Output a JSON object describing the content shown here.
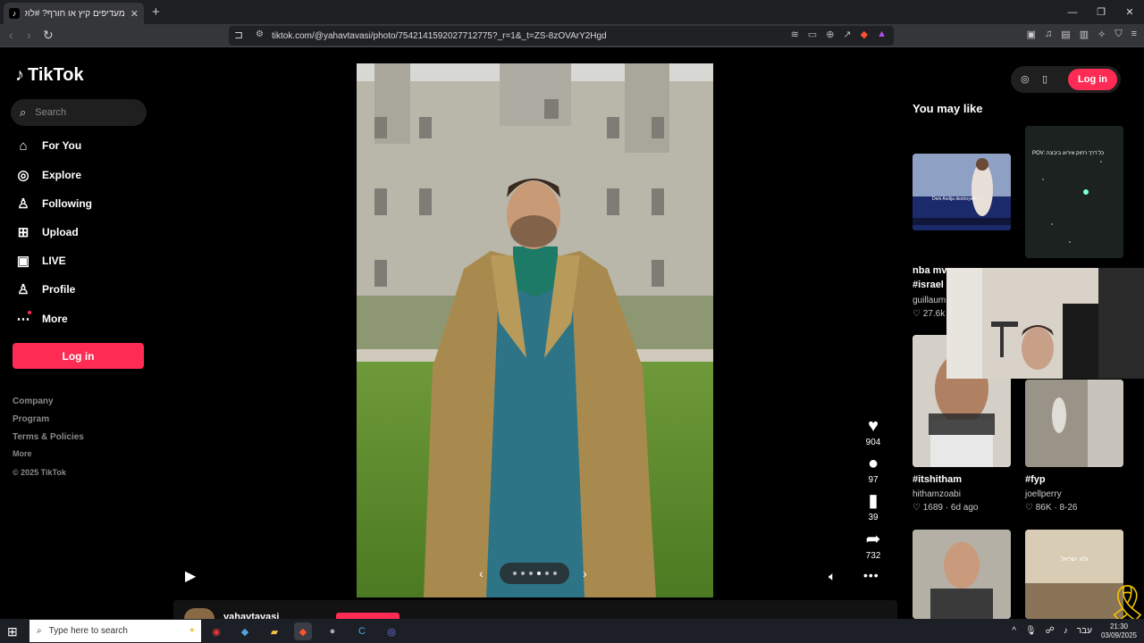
{
  "browser": {
    "tab_title": "מעדיפים קיץ או חורף? #לוקים ש",
    "tab_close": "✕",
    "new_tab": "+",
    "url": "tiktok.com/@yahavtavasi/photo/7542141592027712775?_r=1&_t=ZS-8zOVArY2Hgd",
    "window_controls": [
      "—",
      "❐",
      "✕"
    ]
  },
  "sidebar": {
    "logo": "TikTok",
    "search_placeholder": "Search",
    "nav": [
      {
        "label": "For You",
        "icon": "home-icon"
      },
      {
        "label": "Explore",
        "icon": "compass-icon"
      },
      {
        "label": "Following",
        "icon": "following-icon"
      },
      {
        "label": "Upload",
        "icon": "upload-icon"
      },
      {
        "label": "LIVE",
        "icon": "live-icon"
      },
      {
        "label": "Profile",
        "icon": "profile-icon"
      },
      {
        "label": "More",
        "icon": "more-icon"
      }
    ],
    "login": "Log in",
    "footer": {
      "company": "Company",
      "program": "Program",
      "terms": "Terms & Policies",
      "more": "More",
      "copyright": "© 2025 TikTok"
    }
  },
  "post": {
    "likes": "904",
    "comments": "97",
    "saves": "39",
    "shares": "732",
    "author": "yahavtavasi"
  },
  "right_panel": {
    "login": "Log in",
    "heading": "You may like",
    "cards": [
      {
        "title": "nba mv",
        "tags": "#israel",
        "user": "guillaum",
        "stat": "27.6k"
      },
      {
        "title": "#itshitham",
        "user": "hithamzoabi",
        "likes": "1689",
        "date": "6d ago"
      },
      {
        "title": "#fyp",
        "user": "joellperry",
        "likes": "86K",
        "date": "8-26"
      }
    ],
    "thumb_text_1": "Deni Avdija destroyed ...",
    "thumb_text_2": "POV: כל דרך רחוק אירוע ביבונה",
    "thumb_text_3": "ולא ישראל"
  },
  "taskbar": {
    "search_placeholder": "Type here to search",
    "lang": "עבר",
    "time": "21:30",
    "date": "03/09/2025"
  },
  "colors": {
    "accent": "#fe2c55",
    "background": "#000000"
  }
}
